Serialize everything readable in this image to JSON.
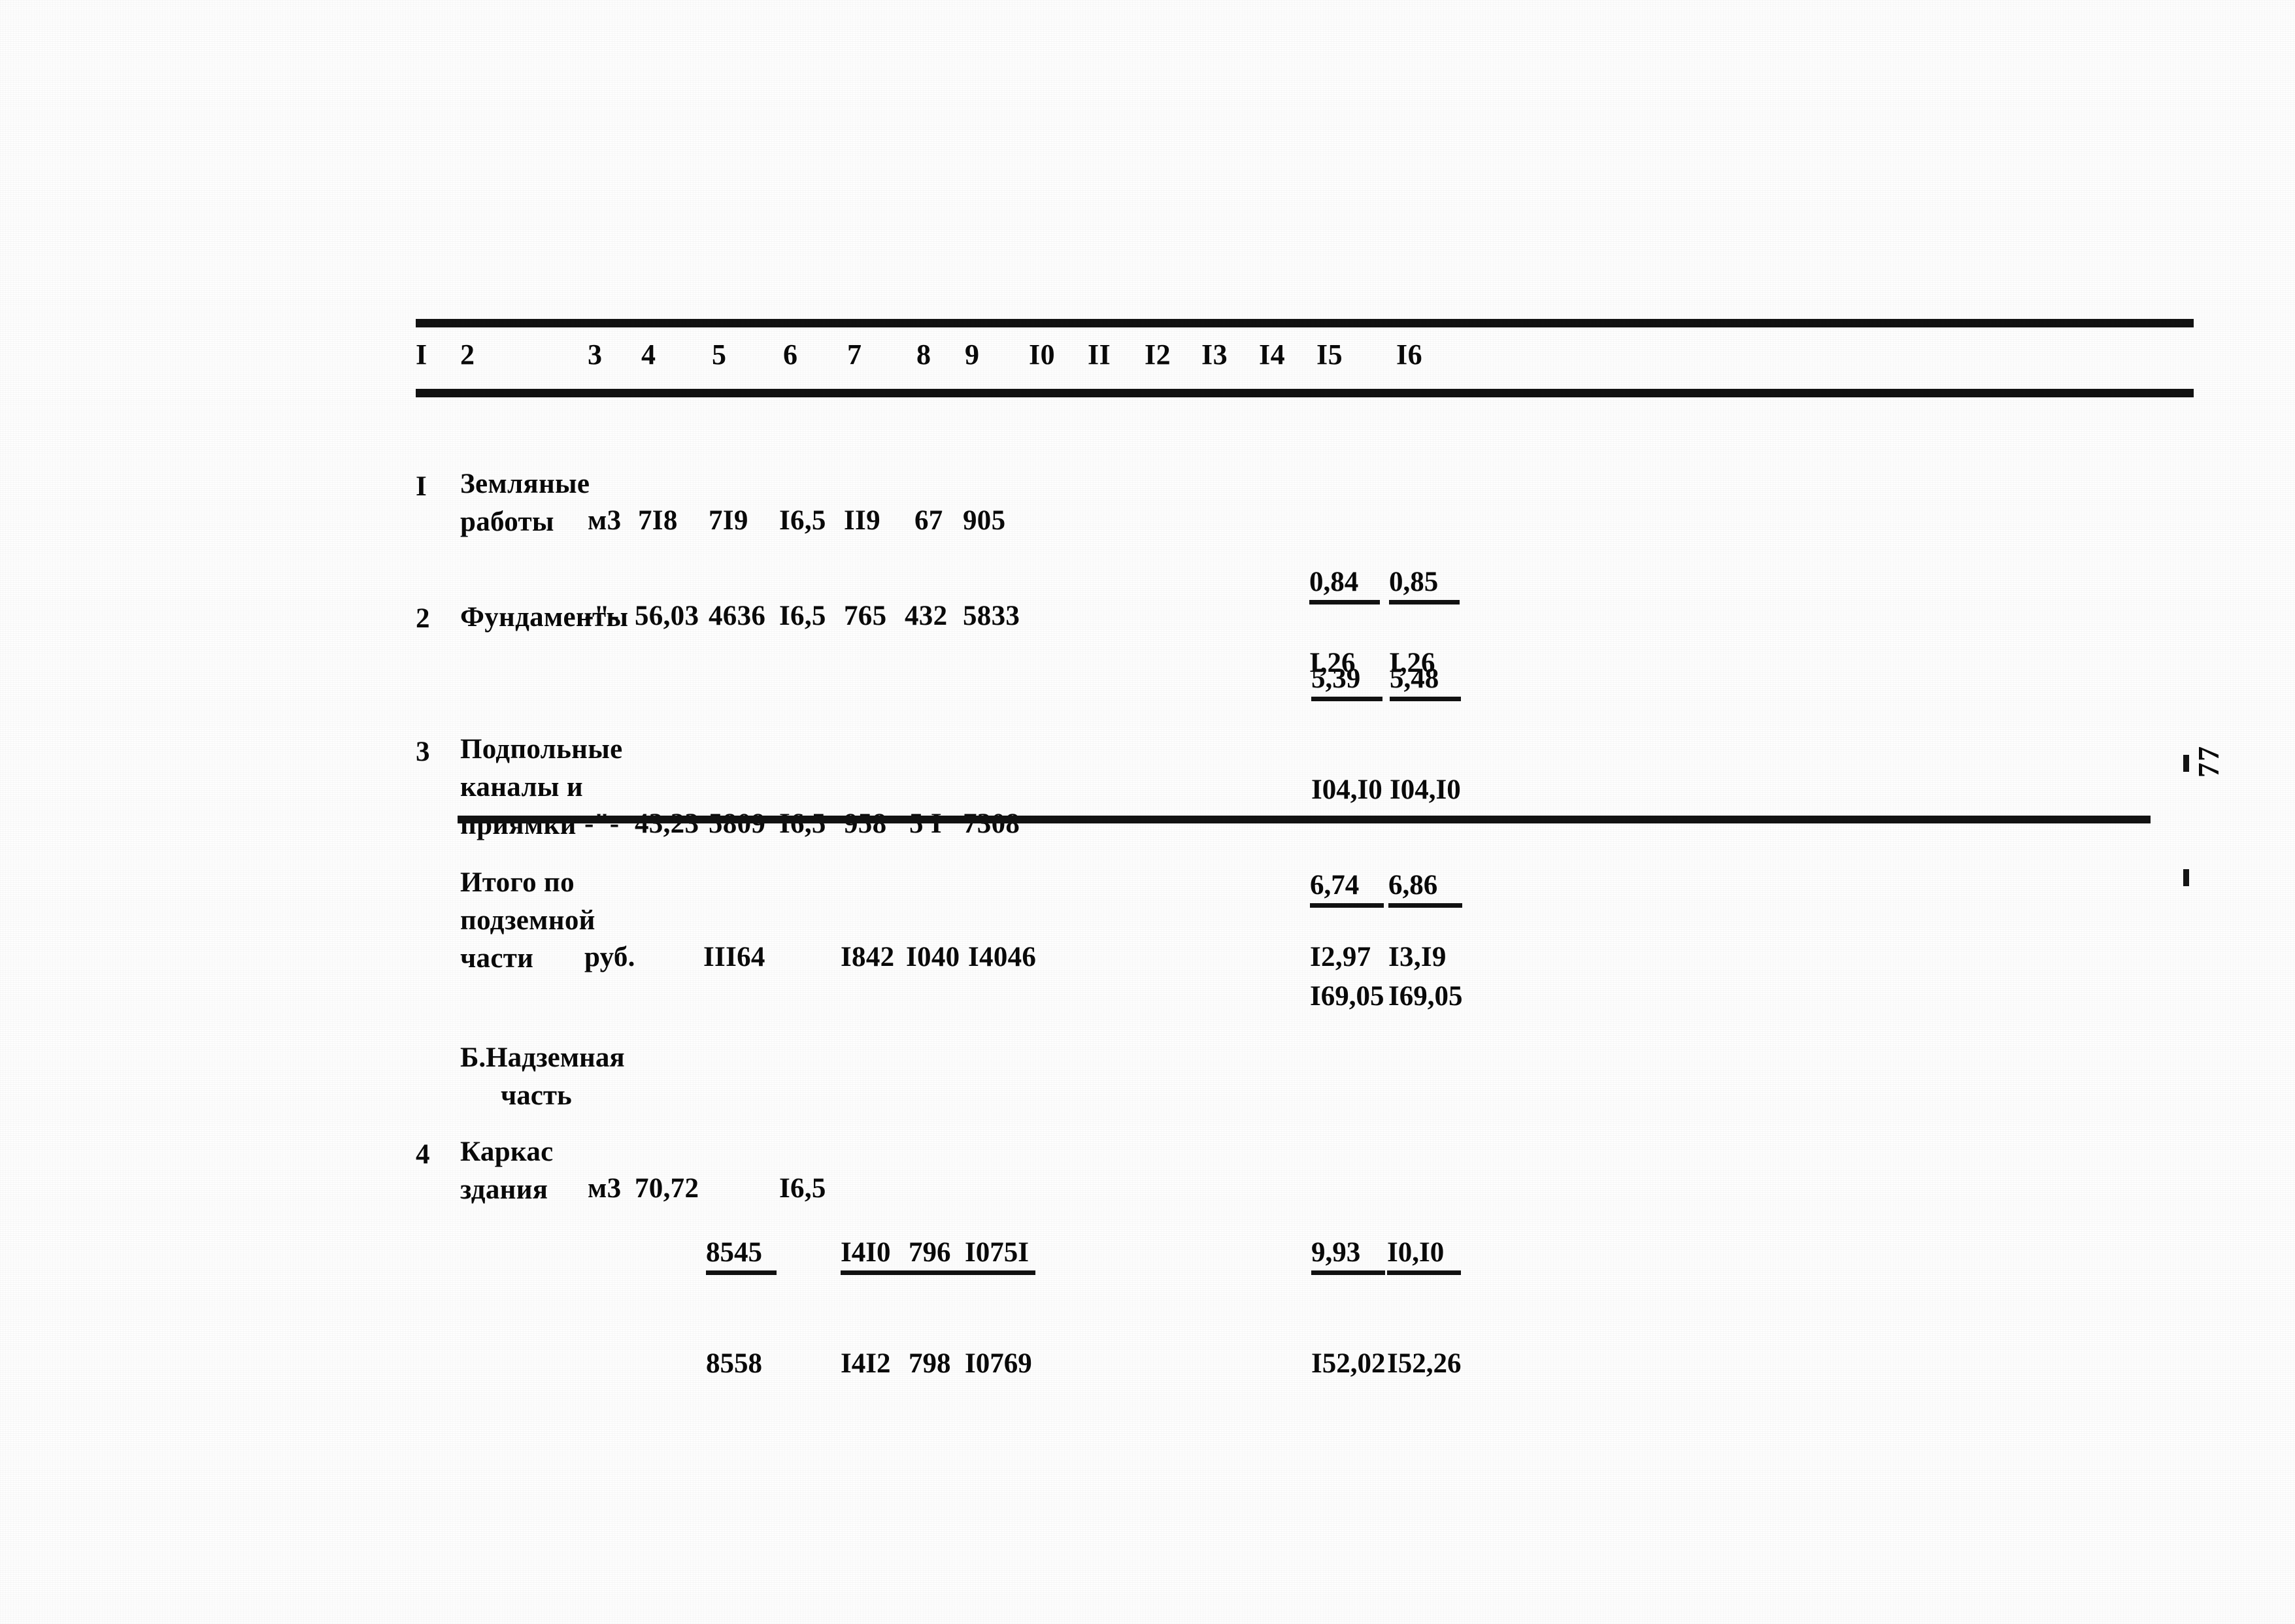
{
  "document": {
    "kind": "typewritten-estimate-table",
    "folio": "77"
  },
  "table": {
    "column_numbers": [
      "I",
      "2",
      "3",
      "4",
      "5",
      "6",
      "7",
      "8",
      "9",
      "I0",
      "II",
      "I2",
      "I3",
      "I4",
      "I5",
      "I6"
    ],
    "rows": [
      {
        "no": "I",
        "name_lines": [
          "Земляные",
          "работы"
        ],
        "unit": "м3",
        "c4": "7I8",
        "c5": "7I9",
        "c6": "I6,5",
        "c7": "II9",
        "c8": "67",
        "c9": "905",
        "c15_top": "0,84",
        "c15_bottom": "I,26",
        "c16_top": "0,85",
        "c16_bottom": "I,26"
      },
      {
        "no": "2",
        "name_lines": [
          "Фундаменты"
        ],
        "unit": "-\"-",
        "c4": "56,03",
        "c5": "4636",
        "c6": "I6,5",
        "c7": "765",
        "c8": "432",
        "c9": "5833",
        "c15_top": "5,39",
        "c15_bottom": "I04,I0",
        "c16_top": "5,48",
        "c16_bottom": "I04,I0"
      },
      {
        "no": "3",
        "name_lines": [
          "Подпольные",
          "каналы и",
          "приямки"
        ],
        "unit": "-\"-",
        "c4": "43,23",
        "c5": "5809",
        "c6": "I6,5",
        "c7": "958",
        "c8": "5 I",
        "c9": "7308",
        "c15_top": "6,74",
        "c15_bottom": "I69,05",
        "c16_top": "6,86",
        "c16_bottom": "I69,05"
      }
    ],
    "subtotal": {
      "name_lines": [
        "Итого по",
        "подземной",
        "части"
      ],
      "unit": "руб.",
      "c5": "III64",
      "c7": "I842",
      "c8": "I040",
      "c9": "I4046",
      "c15": "I2,97",
      "c16": "I3,I9"
    },
    "section_heading": {
      "line1": "Б.Надземная",
      "line2": "часть"
    },
    "row4": {
      "no": "4",
      "name_lines": [
        "Каркас",
        "здания"
      ],
      "unit": "м3",
      "c4": "70,72",
      "c5_top": "8545",
      "c5_bottom": "8558",
      "c6": "I6,5",
      "c7_top": "I4I0",
      "c7_bottom": "I4I2",
      "c8_top": "796",
      "c8_bottom": "798",
      "c9_top": "I075I",
      "c9_bottom": "I0769",
      "c15_top": "9,93",
      "c15_bottom": "I52,02",
      "c16_top": "I0,I0",
      "c16_bottom": "I52,26"
    }
  }
}
